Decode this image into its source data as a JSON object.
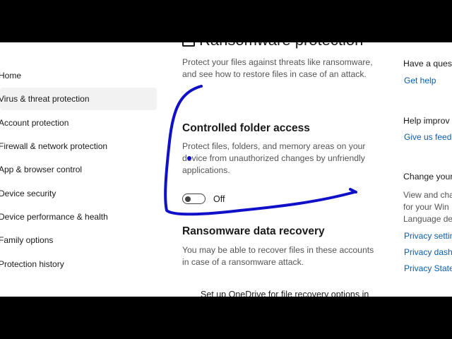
{
  "sidebar": {
    "items": [
      {
        "label": "Home"
      },
      {
        "label": "Virus & threat protection",
        "active": true
      },
      {
        "label": "Account protection"
      },
      {
        "label": "Firewall & network protection"
      },
      {
        "label": "App & browser control"
      },
      {
        "label": "Device security"
      },
      {
        "label": "Device performance & health"
      },
      {
        "label": "Family options"
      },
      {
        "label": "Protection history"
      }
    ]
  },
  "main": {
    "page_title": "Ransomware protection",
    "intro": "Protect your files against threats like ransomware, and see how to restore files in case of an attack.",
    "cfa": {
      "heading": "Controlled folder access",
      "description": "Protect files, folders, and memory areas on your device from unauthorized changes by unfriendly applications.",
      "toggle_state": "Off"
    },
    "recovery": {
      "heading": "Ransomware data recovery",
      "description": "You may be able to recover files in these accounts in case of a ransomware attack.",
      "onedrive_link": "Set up OneDrive for file recovery options in"
    }
  },
  "rightcol": {
    "question_heading": "Have a quest",
    "get_help": "Get help",
    "improve_heading": "Help improv",
    "feedback": "Give us feedb",
    "privacy_heading": "Change your",
    "privacy_text": [
      "View and cha",
      "for your Win",
      "Language de"
    ],
    "privacy_links": [
      "Privacy settin",
      "Privacy dashb",
      "Privacy Stater"
    ]
  },
  "colors": {
    "link": "#0b5cad",
    "annotation": "#1010c8"
  }
}
